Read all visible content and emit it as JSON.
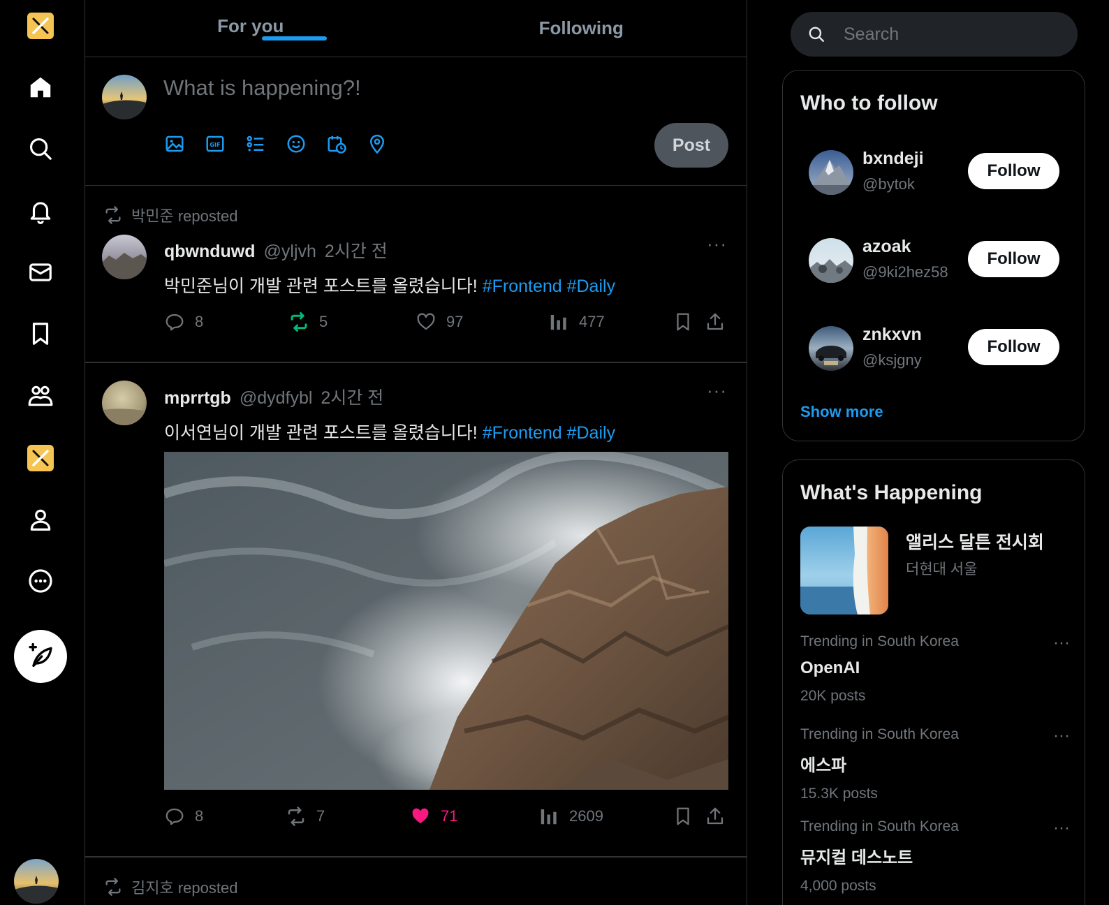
{
  "nav": {
    "items": [
      "logo",
      "home",
      "explore",
      "notifications",
      "messages",
      "bookmarks",
      "communities",
      "premium",
      "profile",
      "more"
    ],
    "compose_label": "Post"
  },
  "tabs": [
    {
      "label": "For you",
      "active": true
    },
    {
      "label": "Following",
      "active": false
    }
  ],
  "composer": {
    "placeholder": "What is happening?!",
    "post_label": "Post",
    "tools": [
      "image-icon",
      "gif-icon",
      "poll-icon",
      "emoji-icon",
      "schedule-icon",
      "location-icon"
    ]
  },
  "tweets": [
    {
      "repost_by": "박민준 reposted",
      "name": "qbwnduwd",
      "handle": "@yljvh",
      "time": "2시간 전",
      "text": "박민준님이 개발 관련 포스트를 올렸습니다! ",
      "hashtags": "#Frontend #Daily",
      "replies": "8",
      "reposts": "5",
      "likes": "97",
      "views": "477",
      "reposted": true,
      "liked": false
    },
    {
      "repost_by": "",
      "name": "mprrtgb",
      "handle": "@dydfybl",
      "time": "2시간 전",
      "text": "이서연님이 개발 관련 포스트를 올렸습니다! ",
      "hashtags": "#Frontend #Daily",
      "replies": "8",
      "reposts": "7",
      "likes": "71",
      "views": "2609",
      "reposted": false,
      "liked": true
    },
    {
      "repost_by": "김지호 reposted"
    }
  ],
  "search": {
    "placeholder": "Search"
  },
  "who_to_follow": {
    "title": "Who to follow",
    "users": [
      {
        "name": "bxndeji",
        "handle": "@bytok",
        "button": "Follow"
      },
      {
        "name": "azoak",
        "handle": "@9ki2hez58",
        "button": "Follow"
      },
      {
        "name": "znkxvn",
        "handle": "@ksjgny",
        "button": "Follow"
      }
    ],
    "show_more": "Show more"
  },
  "whats_happening": {
    "title": "What's Happening",
    "event": {
      "title": "앨리스 달튼 전시회",
      "subtitle": "더현대 서울"
    },
    "trends": [
      {
        "category": "Trending in South Korea",
        "name": "OpenAI",
        "count": "20K posts"
      },
      {
        "category": "Trending in South Korea",
        "name": "에스파",
        "count": "15.3K posts"
      },
      {
        "category": "Trending in South Korea",
        "name": "뮤지컬 데스노트",
        "count": "4,000 posts"
      }
    ]
  },
  "colors": {
    "accent": "#1d9bf0",
    "like": "#f91880",
    "repost": "#00ba7c",
    "logo": "#f6c453",
    "background": "#000000",
    "border": "#2f3336"
  }
}
